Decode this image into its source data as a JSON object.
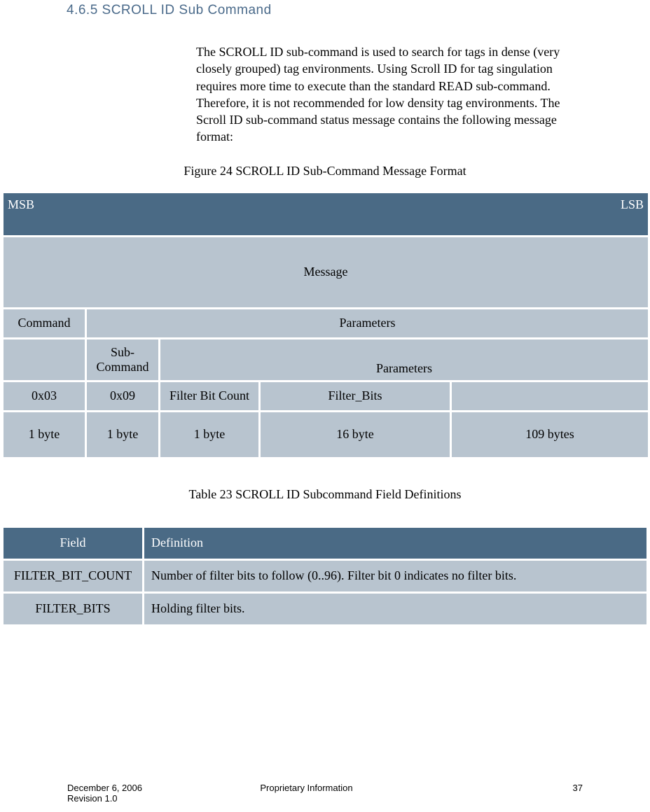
{
  "heading": "4.6.5 SCROLL ID Sub Command",
  "paragraph": "The SCROLL ID sub-command is used to search for tags in dense (very closely grouped) tag environments.  Using Scroll ID for tag singulation requires more time to execute than the standard READ sub-command.  Therefore, it is not recommended for low density tag environments.  The Scroll ID sub-command status message contains the following message format:",
  "figure_caption": "Figure 24 SCROLL ID  Sub-Command Message Format",
  "table1": {
    "msb": "MSB",
    "lsb": "LSB",
    "message": "Message",
    "command": "Command",
    "parameters": "Parameters",
    "sub_command": "Sub-Command",
    "parameters2": "Parameters",
    "vals": [
      "0x03",
      "0x09",
      "Filter Bit Count",
      "Filter_Bits",
      ""
    ],
    "sizes": [
      "1 byte",
      "1 byte",
      "1 byte",
      "16 byte",
      "109 bytes"
    ]
  },
  "table_caption": "Table 23 SCROLL ID Subcommand Field Definitions",
  "table2": {
    "headers": {
      "field": "Field",
      "definition": "Definition"
    },
    "rows": [
      {
        "field": "FILTER_BIT_COUNT",
        "definition": "Number of filter bits to follow (0..96). Filter bit 0 indicates no filter bits."
      },
      {
        "field": "FILTER_BITS",
        "definition": "Holding filter bits."
      }
    ]
  },
  "footer": {
    "date": "December 6, 2006",
    "revision": "Revision 1.0",
    "center": "Proprietary Information",
    "page": "37"
  }
}
